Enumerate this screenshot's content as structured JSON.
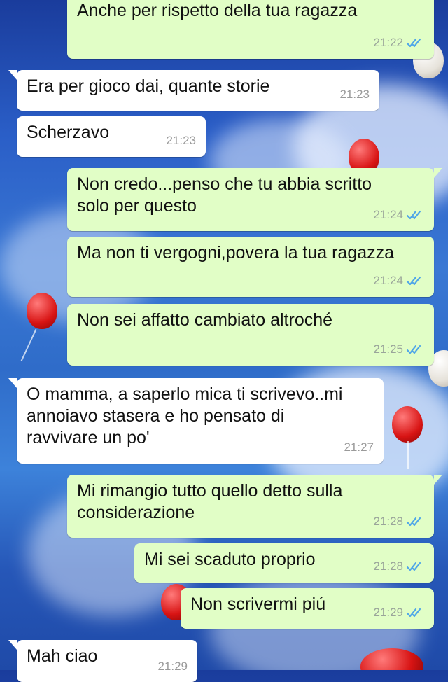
{
  "messages": [
    {
      "id": "m1",
      "direction": "out",
      "text": "Anche per rispetto della tua ragazza",
      "time": "21:22",
      "status": "read"
    },
    {
      "id": "m2",
      "direction": "in",
      "text": "Era per gioco dai, quante storie",
      "time": "21:23"
    },
    {
      "id": "m3",
      "direction": "in",
      "text": "Scherzavo",
      "time": "21:23"
    },
    {
      "id": "m4",
      "direction": "out",
      "text": "Non credo...penso che tu abbia scritto\nsolo per questo",
      "time": "21:24",
      "status": "read"
    },
    {
      "id": "m5",
      "direction": "out",
      "text": "Ma non ti vergogni,povera la tua ragazza",
      "time": "21:24",
      "status": "read"
    },
    {
      "id": "m6",
      "direction": "out",
      "text": "Non sei affatto cambiato altroché",
      "time": "21:25",
      "status": "read"
    },
    {
      "id": "m7",
      "direction": "in",
      "text": "O mamma, a saperlo mica ti scrivevo..mi\nannoiavo stasera e ho pensato di\nravvivare un po'",
      "time": "21:27"
    },
    {
      "id": "m8",
      "direction": "out",
      "text": "Mi rimangio tutto quello detto sulla\nconsiderazione",
      "time": "21:28",
      "status": "read"
    },
    {
      "id": "m9",
      "direction": "out",
      "text": "Mi sei scaduto proprio",
      "time": "21:28",
      "status": "read"
    },
    {
      "id": "m10",
      "direction": "out",
      "text": "Non scrivermi piú",
      "time": "21:29",
      "status": "read"
    },
    {
      "id": "m11",
      "direction": "in",
      "text": "Mah ciao",
      "time": "21:29"
    }
  ],
  "colors": {
    "outgoing_bubble": "#e1fec6",
    "incoming_bubble": "#ffffff",
    "read_ticks": "#4fa6e8",
    "wallpaper": "#2a5ec7"
  },
  "icons": {
    "read_receipt": "double-check-icon"
  }
}
